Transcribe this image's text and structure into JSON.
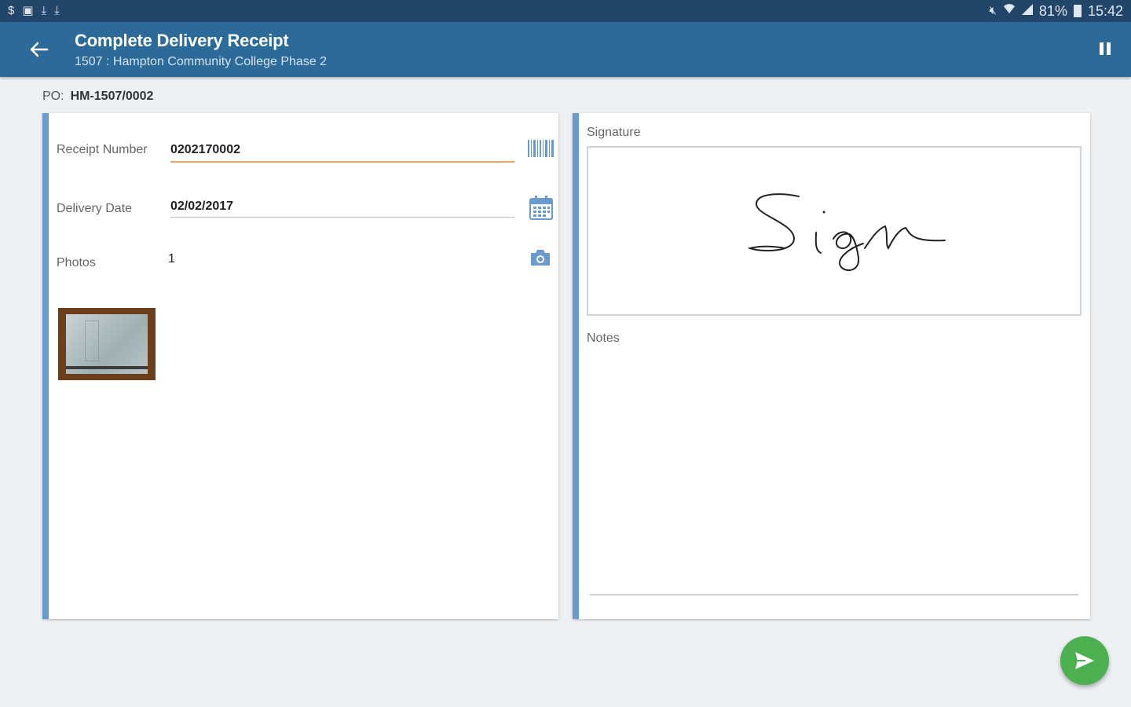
{
  "status_bar": {
    "left_icons": [
      "dollar-icon",
      "gallery-icon",
      "download-icon",
      "download-icon"
    ],
    "battery_percent": "81%",
    "time": "15:42"
  },
  "app_bar": {
    "title": "Complete Delivery Receipt",
    "subtitle": "1507 : Hampton Community College Phase 2"
  },
  "po": {
    "label": "PO:",
    "value": "HM-1507/0002"
  },
  "form": {
    "receipt_number_label": "Receipt Number",
    "receipt_number_value": "0202170002",
    "delivery_date_label": "Delivery Date",
    "delivery_date_value": "02/02/2017",
    "photos_label": "Photos",
    "photos_count": "1"
  },
  "signature": {
    "label": "Signature",
    "signed_text": "Sign"
  },
  "notes": {
    "label": "Notes",
    "value": ""
  },
  "colors": {
    "app_bar": "#2c6a9a",
    "status_bar": "#22466a",
    "accent_underline": "#f0a060",
    "card_accent": "#6a9bcf",
    "fab": "#4caf50"
  }
}
